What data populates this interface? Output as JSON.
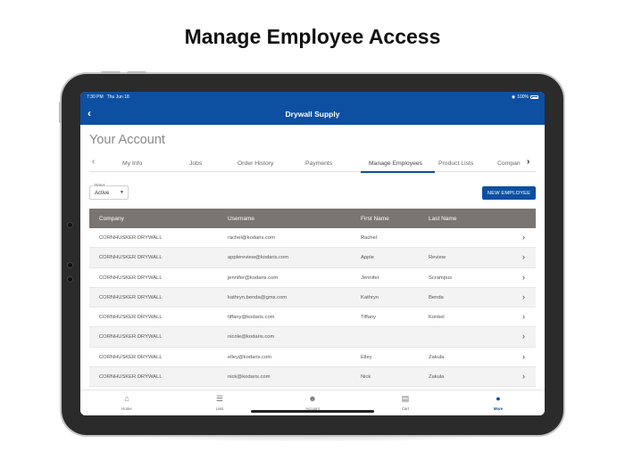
{
  "headline": "Manage Employee Access",
  "statusbar": {
    "time": "7:30 PM",
    "date": "Thu Jun 18",
    "battery": "100%"
  },
  "navbar": {
    "back_icon": "chevron-left-icon",
    "title": "Drywall Supply"
  },
  "page_title": "Your Account",
  "tabs": [
    {
      "label": "My Info"
    },
    {
      "label": "Jobs"
    },
    {
      "label": "Order History"
    },
    {
      "label": "Payments"
    },
    {
      "label": "Manage Employees",
      "active": true
    },
    {
      "label": "Product Lists"
    },
    {
      "label": "Compan"
    }
  ],
  "filter": {
    "label": "Status",
    "value": "Active"
  },
  "new_employee_button": "NEW EMPLOYEE",
  "table": {
    "headers": [
      "Company",
      "Username",
      "First Name",
      "Last Name"
    ],
    "rows": [
      [
        "CORNHUSKER DRYWALL",
        "rachel@kodaris.com",
        "Rachel",
        ""
      ],
      [
        "CORNHUSKER DRYWALL",
        "applereview@kodaris.com",
        "Apple",
        "Review"
      ],
      [
        "CORNHUSKER DRYWALL",
        "jennifer@kodaris.com",
        "Jennifer",
        "Scrampus"
      ],
      [
        "CORNHUSKER DRYWALL",
        "kathryn.benda@gms.com",
        "Kathryn",
        "Benda"
      ],
      [
        "CORNHUSKER DRYWALL",
        "tiffany@kodaris.com",
        "Tiffany",
        "Konkel"
      ],
      [
        "CORNHUSKER DRYWALL",
        "nicole@kodaris.com",
        "",
        ""
      ],
      [
        "CORNHUSKER DRYWALL",
        "elley@kodaris.com",
        "Elley",
        "Zakula"
      ],
      [
        "CORNHUSKER DRYWALL",
        "nick@kodaris.com",
        "Nick",
        "Zakula"
      ]
    ]
  },
  "bottom_nav": [
    {
      "label": "Home",
      "icon": "home-icon"
    },
    {
      "label": "Lists",
      "icon": "list-icon"
    },
    {
      "label": "Account",
      "icon": "account-icon"
    },
    {
      "label": "Cart",
      "icon": "cart-icon"
    },
    {
      "label": "More",
      "icon": "more-icon",
      "active": true
    }
  ],
  "colors": {
    "brand": "#0d4fa1",
    "table_header": "#7a7571"
  }
}
